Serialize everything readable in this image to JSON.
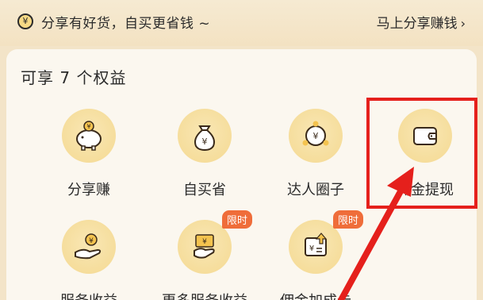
{
  "promo": {
    "coin_glyph": "¥",
    "text": "分享有好货，自买更省钱 ~",
    "link_label": "马上分享赚钱",
    "link_chevron": "›"
  },
  "card": {
    "title": "可享 7 个权益",
    "items": [
      {
        "label": "分享赚",
        "icon": "piggy-bank-icon"
      },
      {
        "label": "自买省",
        "icon": "money-bag-icon"
      },
      {
        "label": "达人圈子",
        "icon": "network-circle-icon"
      },
      {
        "label": "佣金提现",
        "icon": "wallet-icon"
      },
      {
        "label": "服务收益",
        "icon": "hand-coin-icon"
      },
      {
        "label": "更多服务收益",
        "icon": "hand-card-icon",
        "badge": "限时"
      },
      {
        "label": "佣金加成卡",
        "icon": "bonus-card-icon",
        "badge": "限时"
      }
    ]
  },
  "colors": {
    "accent_red": "#e5201c",
    "badge_orange": "#ef6d3a",
    "icon_bg": "#f4d991"
  }
}
